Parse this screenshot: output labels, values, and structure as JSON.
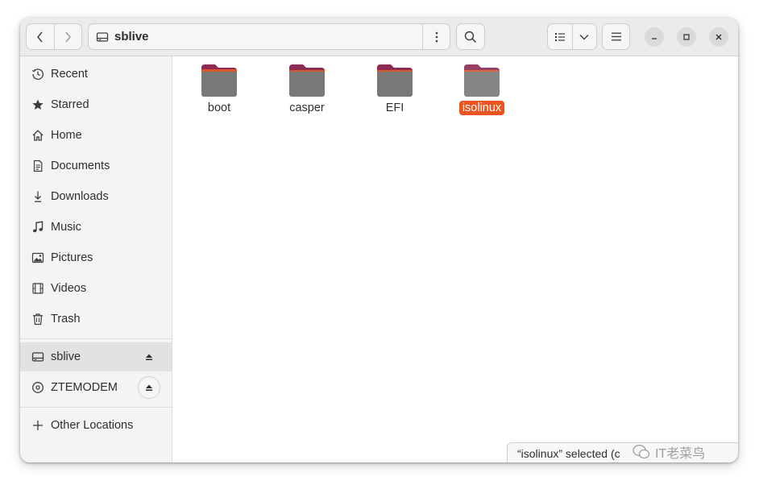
{
  "path": {
    "location": "sblive"
  },
  "sidebar": {
    "items": [
      {
        "label": "Recent",
        "icon": "clock-icon"
      },
      {
        "label": "Starred",
        "icon": "star-icon"
      },
      {
        "label": "Home",
        "icon": "home-icon"
      },
      {
        "label": "Documents",
        "icon": "document-icon"
      },
      {
        "label": "Downloads",
        "icon": "download-icon"
      },
      {
        "label": "Music",
        "icon": "music-icon"
      },
      {
        "label": "Pictures",
        "icon": "picture-icon"
      },
      {
        "label": "Videos",
        "icon": "video-icon"
      },
      {
        "label": "Trash",
        "icon": "trash-icon"
      }
    ],
    "devices": [
      {
        "label": "sblive",
        "icon": "drive-icon",
        "active": true
      },
      {
        "label": "ZTEMODEM",
        "icon": "disc-icon",
        "active": false
      }
    ],
    "other": {
      "label": "Other Locations",
      "icon": "plus-icon"
    }
  },
  "files": [
    {
      "name": "boot",
      "selected": false
    },
    {
      "name": "casper",
      "selected": false
    },
    {
      "name": "EFI",
      "selected": false
    },
    {
      "name": "isolinux",
      "selected": true
    }
  ],
  "status": {
    "text": "“isolinux” selected  (c"
  },
  "watermark": {
    "text": "IT老菜鸟"
  },
  "colors": {
    "accent": "#e95420",
    "folder_body": "#787878",
    "folder_tab": "#8d2b54",
    "folder_edge": "#e95420"
  }
}
